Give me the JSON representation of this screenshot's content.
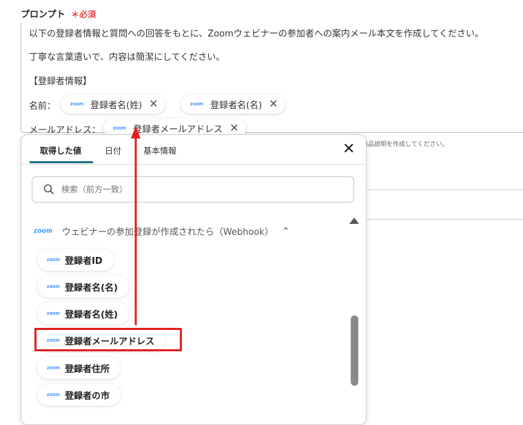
{
  "field": {
    "label": "プロンプト",
    "required_mark": "＊",
    "required_text": "必須"
  },
  "prompt": {
    "line1": "以下の登録者情報と質問への回答をもとに、Zoomウェビナーの参加者への案内メール本文を作成してください。",
    "line2": "丁寧な言葉遣いで、内容は簡潔にしてください。",
    "line3": "【登録者情報】",
    "name_label": "名前：",
    "email_label": "メールアドレス：",
    "chips": [
      {
        "zoom": "zoom",
        "label": "登録者名(姓)",
        "close": "✕"
      },
      {
        "zoom": "zoom",
        "label": "登録者名(名)",
        "close": "✕"
      },
      {
        "zoom": "zoom",
        "label": "登録者メールアドレス",
        "close": "✕"
      }
    ]
  },
  "hint_text": "商品説明を作成してください。",
  "panel": {
    "tabs": [
      "取得した値",
      "日付",
      "基本情報"
    ],
    "close": "✕",
    "search_placeholder": "検索（前方一致）",
    "group": {
      "zoom": "zoom",
      "label": "ウェビナーの参加登録が作成されたら（Webhook）",
      "chevron": "⌃"
    },
    "items": [
      {
        "zoom": "zoom",
        "label": "登録者ID"
      },
      {
        "zoom": "zoom",
        "label": "登録者名(名)"
      },
      {
        "zoom": "zoom",
        "label": "登録者名(姓)"
      },
      {
        "zoom": "zoom",
        "label": "登録者メールアドレス"
      },
      {
        "zoom": "zoom",
        "label": "登録者住所"
      },
      {
        "zoom": "zoom",
        "label": "登録者の市"
      }
    ]
  },
  "colors": {
    "accent": "#1f6f8b",
    "highlight": "#e02020",
    "zoom": "#2d8cff",
    "required": "#e5484d"
  }
}
